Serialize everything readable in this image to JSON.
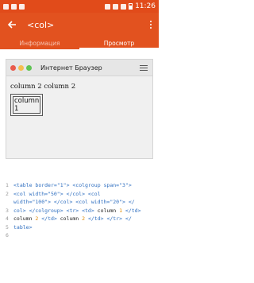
{
  "status_bar": {
    "time": "11:26"
  },
  "app_bar": {
    "title": "<col>",
    "back_icon": "arrow-left-icon",
    "menu_icon": "more-vert-icon"
  },
  "tabs": [
    {
      "label": "Информация",
      "active": false
    },
    {
      "label": "Просмотр",
      "active": true
    }
  ],
  "browser": {
    "title": "Интернет Браузер",
    "row1_text": "column 2 column 2",
    "cell_text_line1": "column",
    "cell_text_line2": "1",
    "traffic_light_colors": [
      "#e95a4c",
      "#f5be4f",
      "#5fc454"
    ]
  },
  "code_lines": [
    {
      "n": "1",
      "parts": [
        [
          "kw",
          "<table "
        ],
        [
          "kw",
          "border="
        ],
        [
          "val",
          "\"1\""
        ],
        [
          "kw",
          "> <colgroup span="
        ],
        [
          "val",
          "\"3\""
        ],
        [
          "kw",
          ">"
        ]
      ]
    },
    {
      "n": "2",
      "parts": [
        [
          "kw",
          "<col width="
        ],
        [
          "val",
          "\"50\""
        ],
        [
          "kw",
          "> </col> <col"
        ]
      ]
    },
    {
      "n": "",
      "parts": [
        [
          "kw",
          "width="
        ],
        [
          "val",
          "\"100\""
        ],
        [
          "kw",
          "> </col> <col width="
        ],
        [
          "val",
          "\"20\""
        ],
        [
          "kw",
          "> </"
        ]
      ]
    },
    {
      "n": "3",
      "parts": [
        [
          "kw",
          "col> </colgroup> <tr> <td> "
        ],
        [
          "txt",
          "column "
        ],
        [
          "num",
          "1"
        ],
        [
          "kw",
          " </td>"
        ]
      ]
    },
    {
      "n": "4",
      "parts": [
        [
          "txt",
          "column "
        ],
        [
          "num",
          "2"
        ],
        [
          "kw",
          " </td> "
        ],
        [
          "txt",
          "column "
        ],
        [
          "num",
          "2"
        ],
        [
          "kw",
          " </td> </tr> </"
        ]
      ]
    },
    {
      "n": "5",
      "parts": [
        [
          "kw",
          "table>"
        ]
      ]
    },
    {
      "n": "6",
      "parts": []
    }
  ]
}
